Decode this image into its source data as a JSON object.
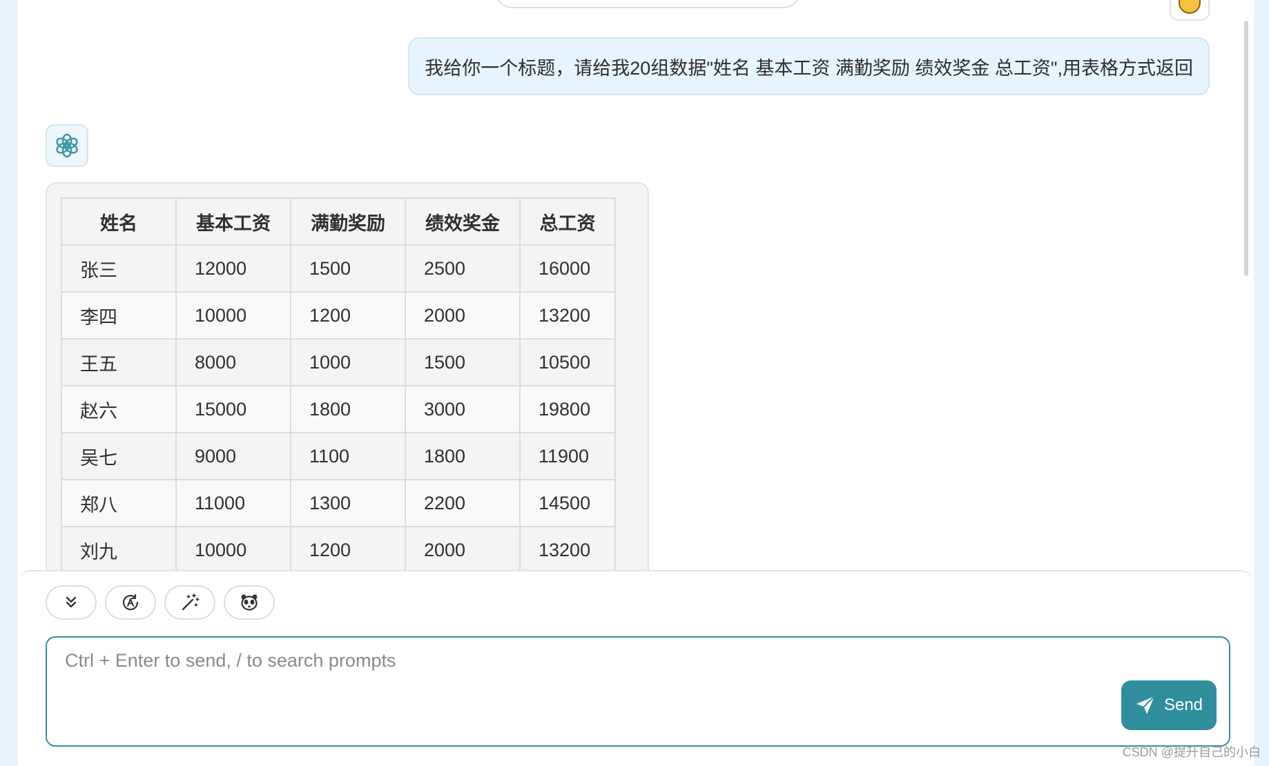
{
  "user_message": "我给你一个标题，请给我20组数据\"姓名 基本工资 满勤奖励 绩效奖金 总工资\",用表格方式返回",
  "table": {
    "headers": [
      "姓名",
      "基本工资",
      "满勤奖励",
      "绩效奖金",
      "总工资"
    ],
    "rows": [
      [
        "张三",
        "12000",
        "1500",
        "2500",
        "16000"
      ],
      [
        "李四",
        "10000",
        "1200",
        "2000",
        "13200"
      ],
      [
        "王五",
        "8000",
        "1000",
        "1500",
        "10500"
      ],
      [
        "赵六",
        "15000",
        "1800",
        "3000",
        "19800"
      ],
      [
        "吴七",
        "9000",
        "1100",
        "1800",
        "11900"
      ],
      [
        "郑八",
        "11000",
        "1300",
        "2200",
        "14500"
      ],
      [
        "刘九",
        "10000",
        "1200",
        "2000",
        "13200"
      ]
    ]
  },
  "toolbar": {
    "icons": [
      "chevrons-down-icon",
      "prompt-a-icon",
      "magic-wand-icon",
      "mask-icon"
    ]
  },
  "input": {
    "placeholder": "Ctrl + Enter to send, / to search prompts"
  },
  "send_label": "Send",
  "watermark": "CSDN @提升自己的小白",
  "colors": {
    "accent": "#2f8f9d",
    "user_bubble": "#e6f4fd",
    "page_bg": "#e9f3fb"
  }
}
